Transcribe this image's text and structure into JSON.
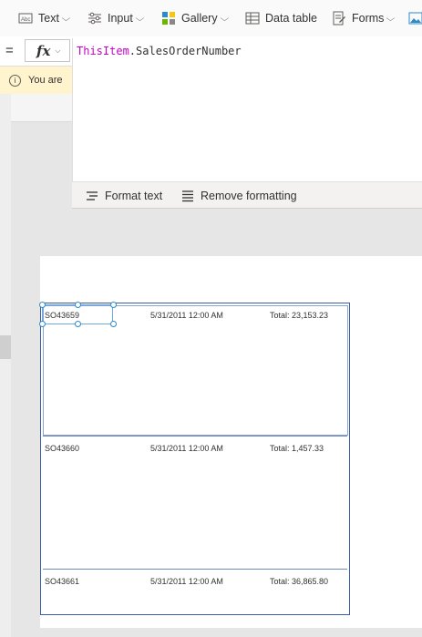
{
  "toolbar": {
    "items": [
      {
        "label": "Text",
        "icon": "text-label-icon",
        "dropdown": true
      },
      {
        "label": "Input",
        "icon": "input-sliders-icon",
        "dropdown": true
      },
      {
        "label": "Gallery",
        "icon": "gallery-icon",
        "dropdown": true
      },
      {
        "label": "Data table",
        "icon": "data-table-icon",
        "dropdown": false
      },
      {
        "label": "Forms",
        "icon": "forms-icon",
        "dropdown": true
      },
      {
        "label": "",
        "icon": "media-image-icon",
        "dropdown": false
      }
    ]
  },
  "formula_bar": {
    "equals": "=",
    "fx_label": "fx",
    "formula_keyword": "ThisItem",
    "formula_rest": ".SalesOrderNumber"
  },
  "info_bar": {
    "text": "You are"
  },
  "editor_footer": {
    "format_text": "Format text",
    "remove_formatting": "Remove formatting"
  },
  "gallery": {
    "rows": [
      {
        "order": "SO43659",
        "date": "5/31/2011 12:00 AM",
        "total": "Total: 23,153.23"
      },
      {
        "order": "SO43660",
        "date": "5/31/2011 12:00 AM",
        "total": "Total: 1,457.33"
      },
      {
        "order": "SO43661",
        "date": "5/31/2011 12:00 AM",
        "total": "Total: 36,865.80"
      }
    ]
  },
  "colors": {
    "keyword": "#c800c8",
    "gallery_border": "#3b5ea8",
    "selection_handle": "#2e8bc6",
    "info_background": "#fff4ce"
  }
}
